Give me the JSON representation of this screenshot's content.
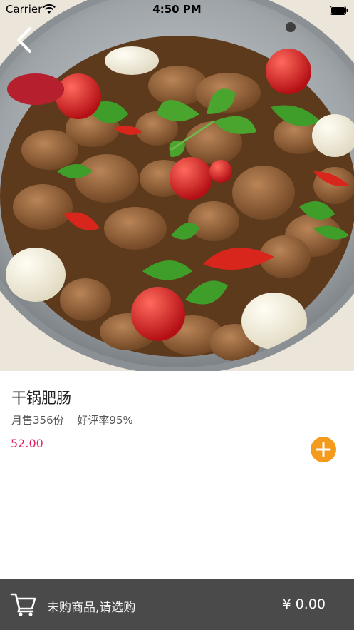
{
  "status_bar": {
    "carrier": "Carrier",
    "time": "4:50 PM",
    "wifi_icon": "wifi-icon",
    "battery_icon": "battery-icon"
  },
  "hero": {
    "image": "dish-photo-dry-pot-pork-intestine"
  },
  "nav": {
    "back_icon": "chevron-left-icon"
  },
  "dish": {
    "name": "干锅肥肠",
    "monthly_sales": "月售356份",
    "rating": "好评率95%",
    "price": "52.00",
    "add_icon": "plus-icon"
  },
  "cart": {
    "icon": "cart-icon",
    "status_text": "未购商品,请选购",
    "total": "¥ 0.00"
  },
  "colors": {
    "price": "#e0245e",
    "add_button": "#f49b1e",
    "cart_bar": "#4a4a4a"
  }
}
